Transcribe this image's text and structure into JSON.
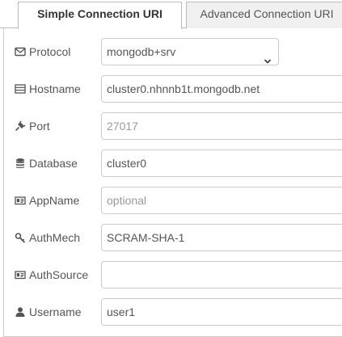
{
  "tabs": [
    {
      "label": "Simple Connection URI",
      "active": true
    },
    {
      "label": "Advanced Connection URI",
      "active": false
    }
  ],
  "form": {
    "protocol": {
      "label": "Protocol",
      "value": "mongodb+srv",
      "icon": "envelope-icon"
    },
    "hostname": {
      "label": "Hostname",
      "value": "cluster0.nhnnb1t.mongodb.net",
      "icon": "server-icon"
    },
    "port": {
      "label": "Port",
      "value": "",
      "placeholder": "27017",
      "icon": "plug-icon"
    },
    "database": {
      "label": "Database",
      "value": "cluster0",
      "icon": "database-icon"
    },
    "appname": {
      "label": "AppName",
      "value": "",
      "placeholder": "optional",
      "icon": "id-card-icon"
    },
    "authmech": {
      "label": "AuthMech",
      "value": "SCRAM-SHA-1",
      "icon": "key-icon"
    },
    "authsource": {
      "label": "AuthSource",
      "value": "",
      "placeholder": "",
      "icon": "id-card-icon"
    },
    "username": {
      "label": "Username",
      "value": "user1",
      "icon": "user-icon"
    }
  }
}
